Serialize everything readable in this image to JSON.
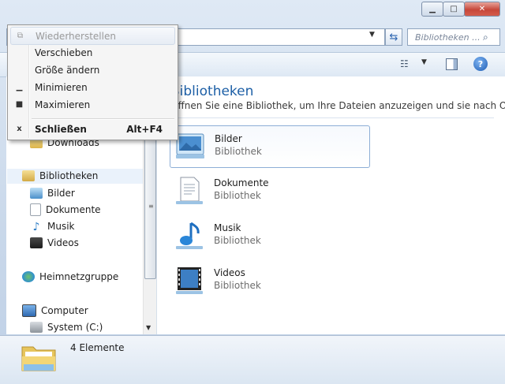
{
  "address": {
    "dropdown_icon": "chevron-down-icon",
    "refresh_icon": "refresh-icon"
  },
  "search": {
    "placeholder": "Bibliotheken ..."
  },
  "toolbar": {
    "view_icon": "view-options-icon",
    "preview_icon": "preview-pane-icon",
    "help_icon": "help-icon",
    "help_glyph": "?"
  },
  "nav": {
    "items": [
      {
        "label": "Downloads",
        "icon": "downloads-folder-icon"
      },
      {
        "label": "Bibliotheken",
        "icon": "libraries-icon"
      },
      {
        "label": "Bilder",
        "icon": "pictures-icon"
      },
      {
        "label": "Dokumente",
        "icon": "documents-icon"
      },
      {
        "label": "Musik",
        "icon": "music-icon"
      },
      {
        "label": "Videos",
        "icon": "videos-icon"
      },
      {
        "label": "Heimnetzgruppe",
        "icon": "homegroup-icon"
      },
      {
        "label": "Computer",
        "icon": "computer-icon"
      },
      {
        "label": "System (C:)",
        "icon": "drive-icon"
      }
    ]
  },
  "content": {
    "title": "Bibliotheken",
    "subtitle": "Öffnen Sie eine Bibliothek, um Ihre Dateien anzuzeigen und sie nach O...",
    "libraries": [
      {
        "name": "Bilder",
        "type": "Bibliothek",
        "icon": "pictures-library-icon"
      },
      {
        "name": "Dokumente",
        "type": "Bibliothek",
        "icon": "documents-library-icon"
      },
      {
        "name": "Musik",
        "type": "Bibliothek",
        "icon": "music-library-icon"
      },
      {
        "name": "Videos",
        "type": "Bibliothek",
        "icon": "videos-library-icon"
      }
    ]
  },
  "status": {
    "count": "4 Elemente"
  },
  "system_menu": {
    "items": [
      {
        "label": "Wiederherstellen",
        "enabled": false,
        "icon": "restore-icon"
      },
      {
        "label": "Verschieben",
        "enabled": true
      },
      {
        "label": "Größe ändern",
        "enabled": true
      },
      {
        "label": "Minimieren",
        "enabled": true,
        "icon": "minimize-icon"
      },
      {
        "label": "Maximieren",
        "enabled": true,
        "icon": "maximize-icon"
      },
      {
        "label": "Schließen",
        "enabled": true,
        "icon": "close-icon",
        "shortcut": "Alt+F4"
      }
    ]
  },
  "colors": {
    "accent": "#1d5fa6",
    "close_button": "#c6473a"
  }
}
